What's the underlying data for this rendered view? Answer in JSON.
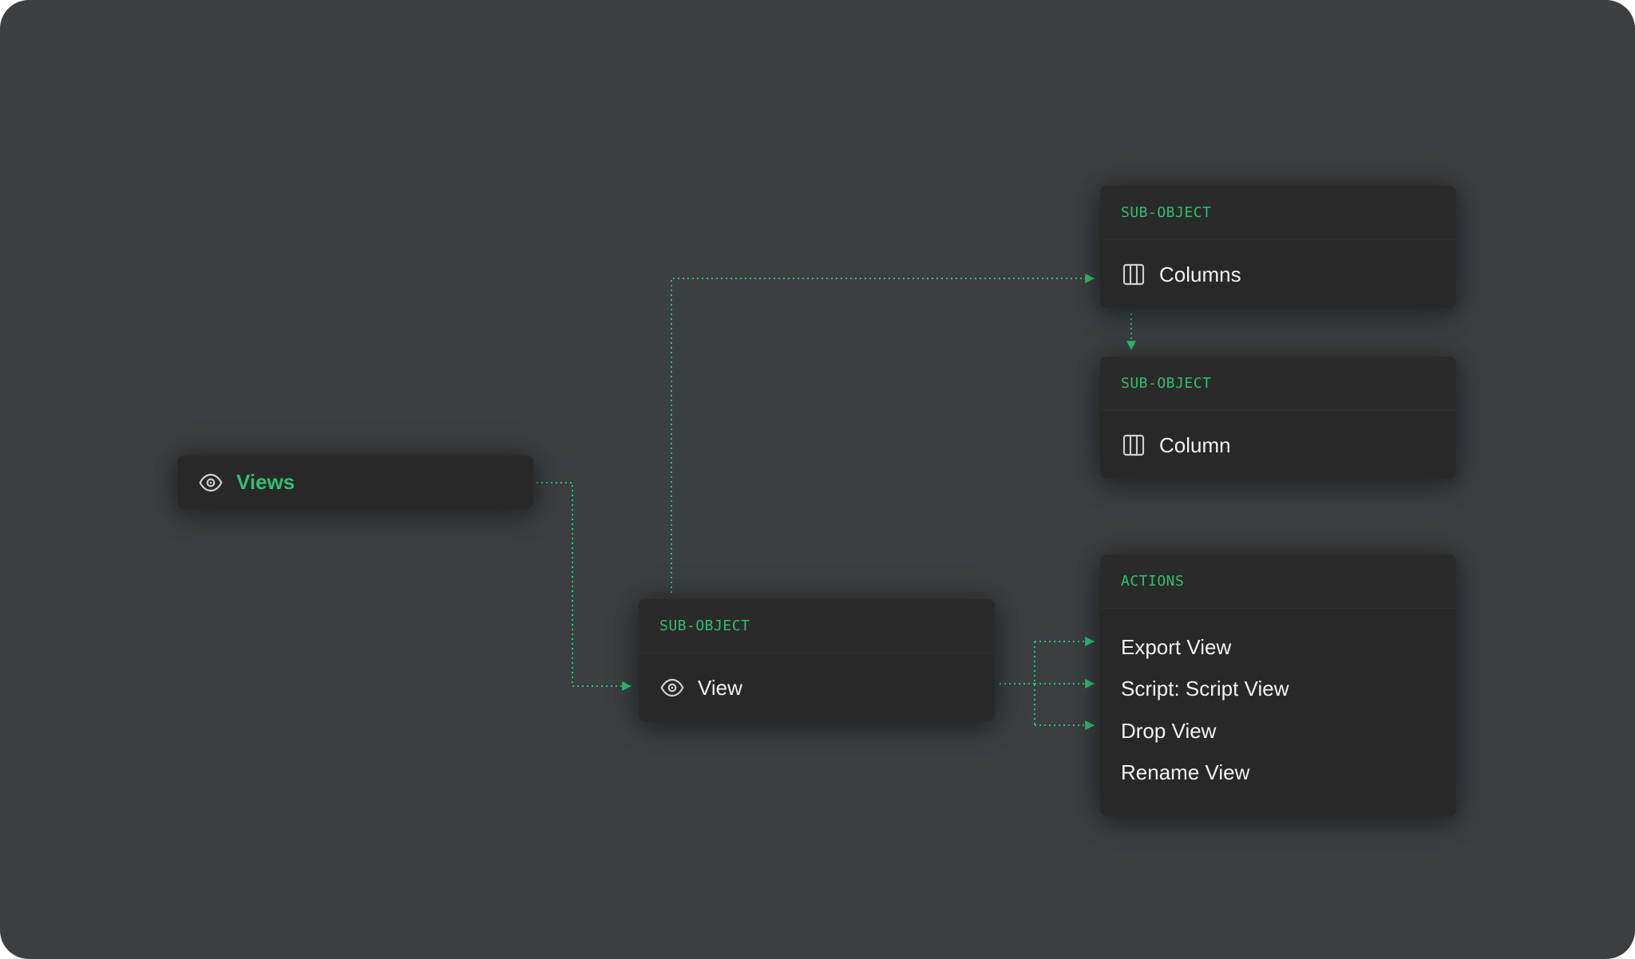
{
  "nodes": {
    "views": {
      "label": "Views",
      "icon": "eye-icon"
    },
    "view": {
      "tag": "SUB-OBJECT",
      "label": "View",
      "icon": "eye-icon"
    },
    "columns": {
      "tag": "SUB-OBJECT",
      "label": "Columns",
      "icon": "columns-icon"
    },
    "column": {
      "tag": "SUB-OBJECT",
      "label": "Column",
      "icon": "columns-icon"
    },
    "actions": {
      "tag": "ACTIONS",
      "items": [
        "Export View",
        "Script: Script View",
        "Drop View",
        "Rename View"
      ]
    }
  },
  "colors": {
    "background": "#3b3f42",
    "card": "#282828",
    "accent": "#2fbf71",
    "text": "#f2f2f2",
    "icon": "#d0d0d0"
  }
}
